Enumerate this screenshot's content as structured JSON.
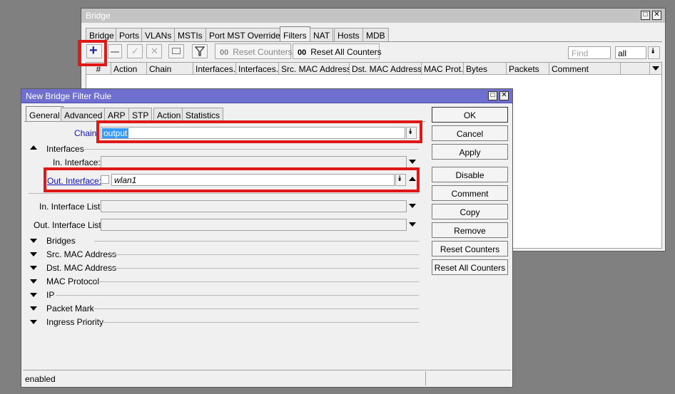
{
  "bridge_window": {
    "title": "Bridge",
    "tabs": [
      "Bridge",
      "Ports",
      "VLANs",
      "MSTIs",
      "Port MST Overrides",
      "Filters",
      "NAT",
      "Hosts",
      "MDB"
    ],
    "selected_tab": "Filters",
    "toolbar": {
      "reset_counters": "Reset Counters",
      "reset_all_counters": "Reset All Counters",
      "counter_prefix": "00",
      "find_placeholder": "Find",
      "filter_value": "all"
    },
    "columns": [
      "#",
      "Action",
      "Chain",
      "Interfaces...",
      "Interfaces...",
      "Src. MAC Address...",
      "Dst. MAC Address...",
      "MAC Prot...",
      "Bytes",
      "Packets",
      "Comment"
    ]
  },
  "rule_window": {
    "title": "New Bridge Filter Rule",
    "tabs": [
      "General",
      "Advanced",
      "ARP",
      "STP",
      "Action",
      "Statistics"
    ],
    "selected_tab": "General",
    "chain": {
      "label": "Chain:",
      "value": "output"
    },
    "interfaces_section": "Interfaces",
    "in_interface": {
      "label": "In. Interface:",
      "value": ""
    },
    "out_interface": {
      "label": "Out. Interface:",
      "value": "wlan1"
    },
    "in_interface_list": {
      "label": "In. Interface List:",
      "value": ""
    },
    "out_interface_list": {
      "label": "Out. Interface List:",
      "value": ""
    },
    "sections": [
      "Bridges",
      "Src. MAC Address",
      "Dst. MAC Address",
      "MAC Protocol",
      "IP",
      "Packet Mark",
      "Ingress Priority"
    ],
    "buttons": [
      "OK",
      "Cancel",
      "Apply",
      "Disable",
      "Comment",
      "Copy",
      "Remove",
      "Reset Counters",
      "Reset All Counters"
    ],
    "status": "enabled"
  },
  "colors": {
    "highlight": "#e01818",
    "active_title": "#6f6fd0",
    "selection": "#3399ff"
  }
}
